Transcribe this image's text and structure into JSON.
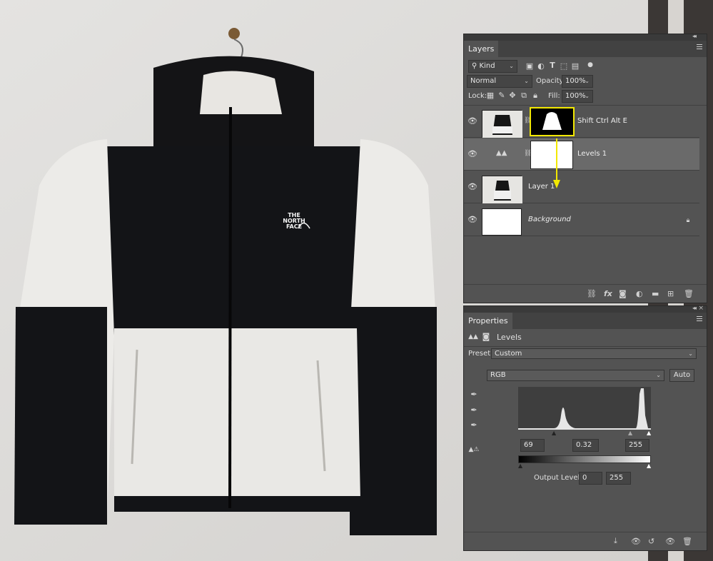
{
  "layers_panel": {
    "tab": "Layers",
    "filter_kind": "Kind",
    "blend_mode": "Normal",
    "opacity_label": "Opacity:",
    "opacity_value": "100%",
    "lock_label": "Lock:",
    "fill_label": "Fill:",
    "fill_value": "100%",
    "layers": [
      {
        "name": "Shift Ctrl Alt E",
        "thumb": "jacket",
        "mask": "jacket-mask",
        "italic": false,
        "selected": false
      },
      {
        "name": "Levels 1",
        "thumb": "levels-adjustment-icon",
        "mask": "white",
        "italic": false,
        "selected": true
      },
      {
        "name": "Layer 1",
        "thumb": "jacket",
        "mask": null,
        "italic": false,
        "selected": false
      },
      {
        "name": "Background",
        "thumb": "white",
        "mask": null,
        "italic": true,
        "selected": false,
        "locked": true
      }
    ],
    "highlight_color": "#f2e800"
  },
  "properties_panel": {
    "tab": "Properties",
    "adjustment_title": "Levels",
    "preset_label": "Preset:",
    "preset_value": "Custom",
    "channel": "RGB",
    "auto_button": "Auto",
    "input_black": "69",
    "input_gamma": "0.32",
    "input_white": "255",
    "output_label": "Output Levels:",
    "output_black": "0",
    "output_white": "255"
  },
  "photo": {
    "logo_line1": "THE",
    "logo_line2": "NORTH",
    "logo_line3": "FACE"
  }
}
